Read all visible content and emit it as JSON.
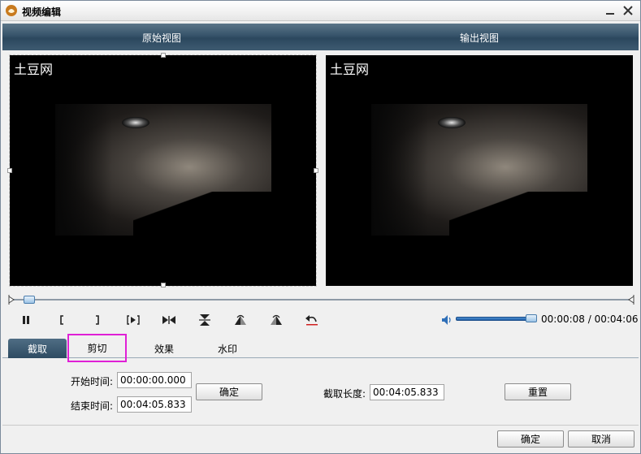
{
  "window": {
    "title": "视频编辑"
  },
  "views": {
    "original": "原始视图",
    "output": "输出视图"
  },
  "overlay": {
    "logo_text": "土豆网"
  },
  "playback": {
    "current_time": "00:00:08",
    "total_time": "00:04:06",
    "time_text": "00:00:08 / 00:04:06",
    "volume_level": 1.0,
    "timeline_position": 0.02
  },
  "controls": [
    "pause-icon",
    "mark-in-icon",
    "mark-out-icon",
    "play-segment-icon",
    "split-icon",
    "flip-vertical-icon",
    "rotate-right-icon",
    "rotate-left-icon",
    "undo-icon"
  ],
  "tabs": [
    {
      "label": "截取",
      "active": true
    },
    {
      "label": "剪切",
      "active": false
    },
    {
      "label": "效果",
      "active": false
    },
    {
      "label": "水印",
      "active": false
    }
  ],
  "trim": {
    "start_label": "开始时间:",
    "start_value": "00:00:00.000",
    "end_label": "结束时间:",
    "end_value": "00:04:05.833",
    "confirm_label": "确定",
    "length_label": "截取长度:",
    "length_value": "00:04:05.833",
    "reset_label": "重置"
  },
  "footer": {
    "ok_label": "确定",
    "cancel_label": "取消"
  },
  "colors": {
    "header": "#36536a",
    "highlight": "#e020d6",
    "volume": "#1f5ea8"
  }
}
